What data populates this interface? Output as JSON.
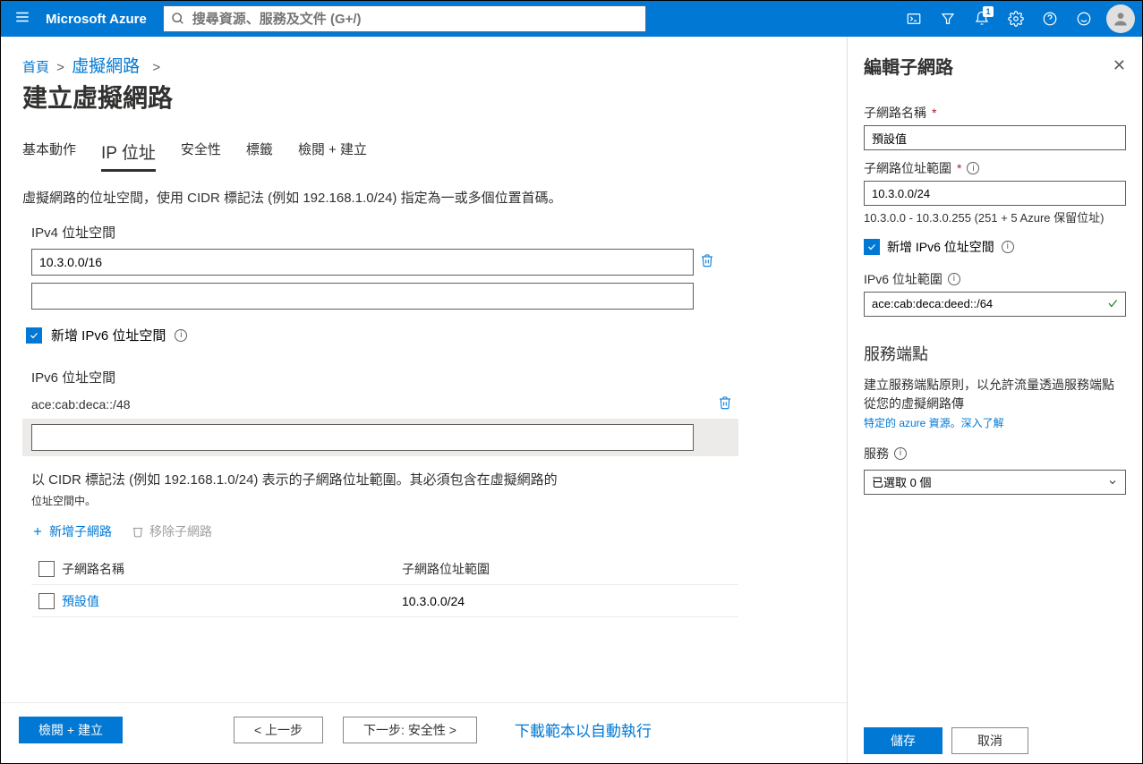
{
  "topbar": {
    "brand": "Microsoft Azure",
    "search_placeholder": "搜尋資源、服務及文件 (G+/)",
    "notification_badge": "1"
  },
  "breadcrumb": {
    "home": "首頁",
    "vnet": "虛擬網路"
  },
  "page_title": "建立虛擬網路",
  "tabs": {
    "basic": "基本動作",
    "ip": "IP 位址",
    "security": "安全性",
    "tags": "標籤",
    "review": "檢閱 + 建立"
  },
  "desc": "虛擬網路的位址空間，使用 CIDR 標記法 (例如 192.168.1.0/24) 指定為一或多個位置首碼。",
  "ipv4": {
    "label": "IPv4 位址空間",
    "value": "10.3.0.0/16"
  },
  "ipv6_checkbox": "新增 IPv6 位址空間",
  "ipv6": {
    "label": "IPv6 位址空間",
    "value": "ace:cab:deca::/48"
  },
  "subnet_desc": "以 CIDR 標記法 (例如 192.168.1.0/24) 表示的子網路位址範圍。其必須包含在虛擬網路的",
  "subnet_desc2": "位址空間中。",
  "subnet_actions": {
    "add": "新增子網路",
    "remove": "移除子網路"
  },
  "subnet_table": {
    "col1": "子網路名稱",
    "col2": "子網路位址範圍",
    "row1_name": "預設值",
    "row1_range": "10.3.0.0/24"
  },
  "bottom": {
    "review": "檢閱 + 建立",
    "prev": "< 上一步",
    "next": "下一步: 安全性 >",
    "download": "下載範本以自動執行"
  },
  "panel": {
    "title": "編輯子網路",
    "name_label": "子網路名稱",
    "name_value": "預設值",
    "range_label": "子網路位址範圍",
    "range_value": "10.3.0.0/24",
    "range_hint": "10.3.0.0 - 10.3.0.255 (251 + 5 Azure 保留位址)",
    "ipv6_check": "新增 IPv6 位址空間",
    "ipv6_range_label": "IPv6 位址範圍",
    "ipv6_range_value": "ace:cab:deca:deed::/64",
    "svc_title": "服務端點",
    "svc_desc": "建立服務端點原則，以允許流量透過服務端點從您的虛擬網路傳",
    "svc_link": "特定的 azure 資源。深入了解",
    "svc_label": "服務",
    "svc_selected": "已選取 0 個",
    "save": "儲存",
    "cancel": "取消"
  }
}
